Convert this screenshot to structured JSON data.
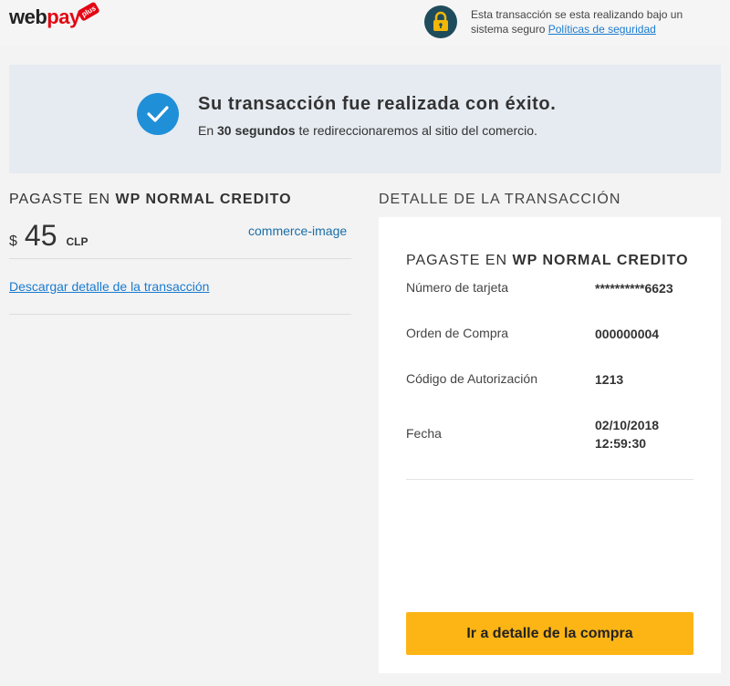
{
  "header": {
    "logo_web": "web",
    "logo_pay": "pay",
    "logo_plus": "plus",
    "secure_text": "Esta transacción se esta realizando bajo un sistema seguro",
    "secure_link": "Políticas de seguridad",
    "icon": "lock-icon"
  },
  "success": {
    "icon": "check-icon",
    "title": "Su transacción fue realizada con éxito.",
    "sub_prefix": "En",
    "sub_bold": "30 segundos",
    "sub_suffix": "te redireccionaremos al sitio del comercio.",
    "color": "#1f8fd8"
  },
  "payment": {
    "paid_at_prefix": "PAGASTE EN",
    "paid_at_name": "WP NORMAL CREDITO",
    "currency_symbol": "$",
    "amount": "45",
    "currency": "CLP",
    "commerce_image_alt": "commerce-image",
    "download_link": "Descargar detalle de la transacción"
  },
  "detail": {
    "title": "DETALLE DE LA TRANSACCIÓN",
    "paid_at_prefix": "PAGASTE EN",
    "paid_at_name": "WP NORMAL CREDITO",
    "rows": [
      {
        "label": "Número de tarjeta",
        "value": "**********6623"
      },
      {
        "label": "Orden de Compra",
        "value": "000000004"
      },
      {
        "label": "Código de Autorización",
        "value": "1213"
      },
      {
        "label": "Fecha",
        "value": "02/10/2018",
        "value2": "12:59:30"
      }
    ],
    "button": "Ir a detalle de la compra",
    "button_color": "#fdb515"
  }
}
